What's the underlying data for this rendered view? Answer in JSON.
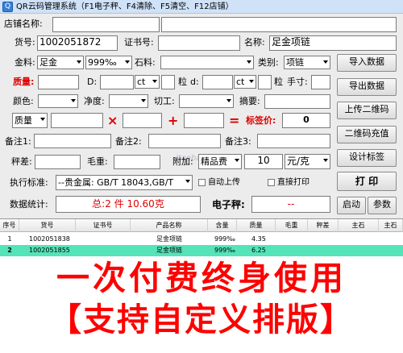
{
  "window": {
    "title": "QR云码管理系统（F1电子秤、F4清除、F5清空、F12店铺）",
    "icon": "qr-app-icon"
  },
  "form": {
    "shop_name_label": "店铺名称:",
    "shop_name_value": "",
    "goods_no_label": "货号:",
    "goods_no_value": "1002051872",
    "cert_no_label": "证书号:",
    "cert_no_value": "",
    "name_label": "名称:",
    "name_value": "足金项链",
    "metal_label": "金料:",
    "metal_value": "足金",
    "purity_value": "999‰",
    "stone_label": "石料:",
    "stone_value": "",
    "category_label": "类别:",
    "category_value": "项链",
    "quality_label": "质量:",
    "d_label": "D:",
    "ct_unit_1": "ct",
    "grain_label_1": "粒",
    "d2_label": "d:",
    "ct_unit_2": "ct",
    "grain_label_2": "粒",
    "handfee_label": "手寸:",
    "color_label": "颜色:",
    "clarity_label": "净度:",
    "cut_label": "切工:",
    "summary_label": "摘要:",
    "formula_field": "质量",
    "multiply_symbol": "×",
    "plus_symbol": "+",
    "equals_symbol": "=",
    "tag_price_label": "标签价:",
    "tag_price_value": "0",
    "note1_label": "备注1:",
    "note2_label": "备注2:",
    "note3_label": "备注3:",
    "scale_diff_label": "秤差:",
    "gross_weight_label": "毛重:",
    "extra_label": "附加:",
    "extra_type": "精品费",
    "extra_value": "10",
    "extra_unit": "元/克",
    "standard_label": "执行标准:",
    "standard_value": "--贵金属: GB/T 18043,GB/T",
    "auto_upload_label": "自动上传",
    "direct_print_label": "直接打印",
    "stats_label": "数据统计:",
    "stats_value": "总:2 件  10.60克",
    "scale_label": "电子秤:",
    "scale_value": "--"
  },
  "buttons": {
    "import": "导入数据",
    "export": "导出数据",
    "upload_qr": "上传二维码",
    "recharge_qr": "二维码充值",
    "design_label": "设计标签",
    "print": "打 印",
    "start": "启动",
    "params": "参数"
  },
  "watermark": "itaobao.taobao.com",
  "table": {
    "columns": [
      "序号",
      "货号",
      "证书号",
      "产品名称",
      "含量",
      "质量",
      "毛重",
      "秤差",
      "主石",
      "主石"
    ],
    "rows": [
      {
        "no": "1",
        "goods_no": "1002051838",
        "cert": "",
        "name": "足金项链",
        "purity": "999‰",
        "weight": "4.35"
      },
      {
        "no": "2",
        "goods_no": "1002051855",
        "cert": "",
        "name": "足金项链",
        "purity": "999‰",
        "weight": "6.25"
      }
    ]
  },
  "promo": {
    "line1": "一次付费终身使用",
    "line2": "【支持自定义排版】"
  },
  "colors": {
    "accent_red": "#e00000",
    "selected_row": "#55e3b8",
    "promo_red": "#ff0000"
  }
}
